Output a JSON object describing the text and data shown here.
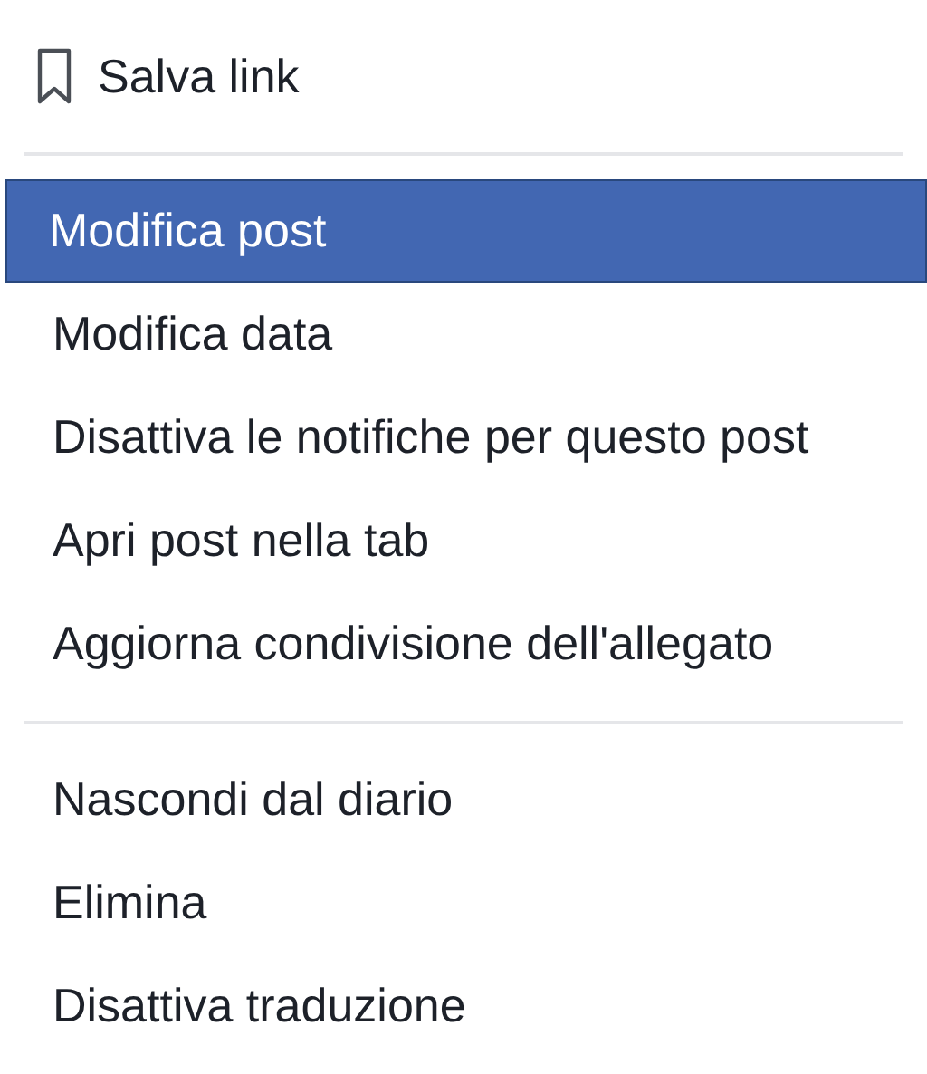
{
  "save_item": {
    "label": "Salva link"
  },
  "sections": [
    {
      "items": [
        {
          "label": "Modifica post",
          "selected": true
        },
        {
          "label": "Modifica data",
          "selected": false
        },
        {
          "label": "Disattiva le notifiche per questo post",
          "selected": false
        },
        {
          "label": "Apri post nella tab",
          "selected": false
        },
        {
          "label": "Aggiorna condivisione dell'allegato",
          "selected": false
        }
      ]
    },
    {
      "items": [
        {
          "label": "Nascondi dal diario",
          "selected": false
        },
        {
          "label": "Elimina",
          "selected": false
        },
        {
          "label": "Disattiva traduzione",
          "selected": false
        }
      ]
    }
  ]
}
